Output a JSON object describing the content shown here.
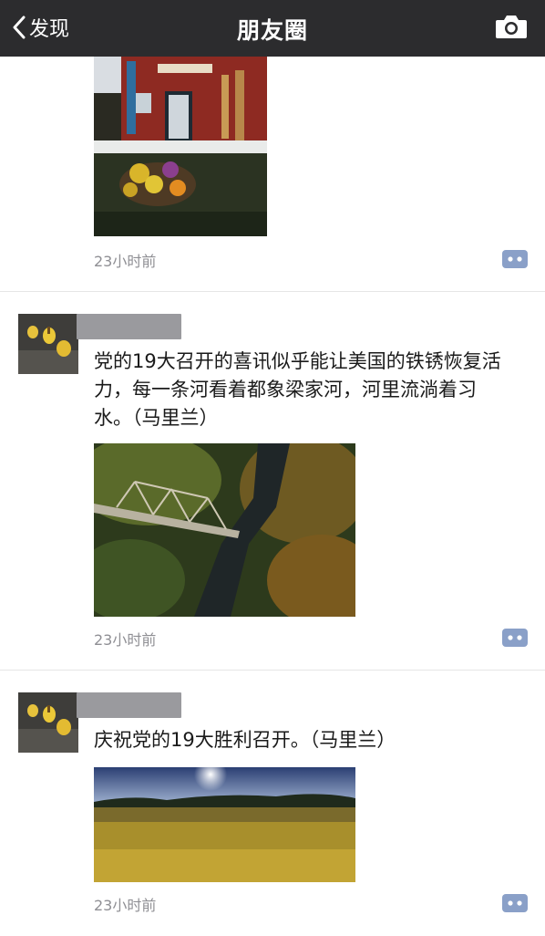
{
  "header": {
    "back_label": "发现",
    "title": "朋友圈",
    "camera_icon": "camera-icon"
  },
  "posts": [
    {
      "text": "",
      "time": "23小时前"
    },
    {
      "text": "党的19大召开的喜讯似乎能让美国的铁锈恢复活力，每一条河看着都象梁家河，河里流淌着习水。（马里兰）",
      "time": "23小时前"
    },
    {
      "text": "庆祝党的19大胜利召开。（马里兰）",
      "time": "23小时前"
    }
  ],
  "colors": {
    "navbar": "#2c2c2e",
    "comment_button": "#8aa0c8",
    "name_mask": "#9a9a9e",
    "time_text": "#8f8f94"
  }
}
